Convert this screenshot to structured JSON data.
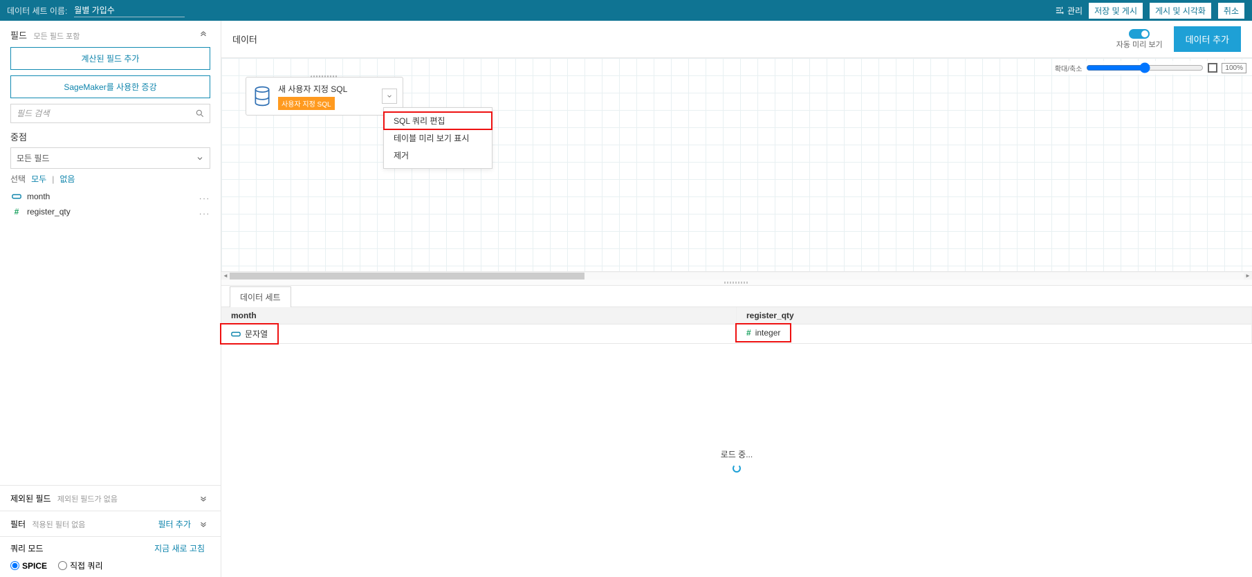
{
  "topbar": {
    "dataset_name_label": "데이터 세트 이름:",
    "dataset_name": "월별 가입수",
    "manage_label": "관리",
    "save_publish": "저장 및 게시",
    "publish_visualize": "게시 및 시각화",
    "cancel": "취소"
  },
  "sidebar": {
    "fields_label": "필드",
    "fields_sub": "모든 필드 포함",
    "calc_field_btn": "계산된 필드 추가",
    "sagemaker_btn": "SageMaker를 사용한 증강",
    "search_placeholder": "필드 검색",
    "focus_label": "중점",
    "focus_value": "모든 필드",
    "select_label": "선택",
    "select_all": "모두",
    "select_none": "없음",
    "field_items": [
      {
        "name": "month",
        "type": "text"
      },
      {
        "name": "register_qty",
        "type": "num"
      }
    ],
    "excluded_label": "제외된 필드",
    "excluded_sub": "제외된 필드가 없음",
    "filter_label": "필터",
    "filter_sub": "적용된 필터 없음",
    "filter_add": "필터 추가",
    "query_mode_label": "쿼리 모드",
    "refresh_now": "지금 새로 고침",
    "spice_label": "SPICE",
    "direct_label": "직접 쿼리"
  },
  "main": {
    "data_label": "데이터",
    "preview_label": "자동 미리 보기",
    "add_data_btn": "데이터 추가",
    "zoom_label": "확대/축소",
    "zoom_pct": "100",
    "node_title": "새 사용자 지정 SQL",
    "node_badge": "사용자 지정 SQL",
    "menu": {
      "edit_sql": "SQL 쿼리 편집",
      "preview_table": "테이블 미리 보기 표시",
      "remove": "제거"
    },
    "dataset_tab": "데이터 세트",
    "columns": [
      {
        "header": "month",
        "type_label": "문자열",
        "type": "text"
      },
      {
        "header": "register_qty",
        "type_label": "integer",
        "type": "num"
      }
    ],
    "loading": "로드 중..."
  }
}
